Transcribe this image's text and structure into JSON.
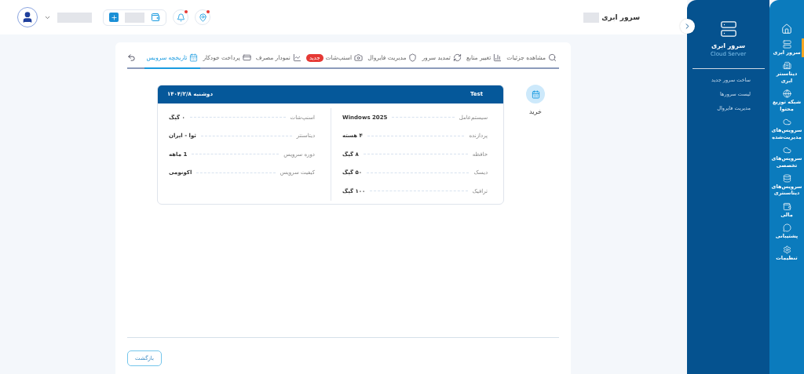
{
  "header": {
    "breadcrumb": "سرور ابری",
    "alerts": [
      {
        "kind": "bell",
        "alert": true
      },
      {
        "kind": "pin",
        "alert": true
      }
    ]
  },
  "rail": [
    {
      "selected": false
    },
    {
      "label": "سرور ابری",
      "selected": true
    },
    {
      "label": "دیتاسنتر ابری",
      "selected": false
    },
    {
      "label": "شبکه توزیع محتوا",
      "selected": false
    },
    {
      "label": "سرویس‌های مدیریت‌شده",
      "selected": false
    },
    {
      "label": "سرویس‌های تخصصی",
      "selected": false
    },
    {
      "label": "سرویس‌های دیتاسنتری",
      "selected": false
    },
    {
      "label": "مالی",
      "selected": false
    },
    {
      "label": "پشتیبانی",
      "selected": false
    },
    {
      "label": "تنظیمات",
      "selected": false
    }
  ],
  "panel": {
    "title": "سرور ابری",
    "subtitle": "Cloud Server",
    "links": [
      "ساخت سرور جدید",
      "لیست سرورها",
      "مدیریت فایروال"
    ]
  },
  "tabs": [
    {
      "label": "مشاهده جزئیات",
      "selected": false
    },
    {
      "label": "تغییر منابع",
      "selected": false
    },
    {
      "label": "تمدید سرور",
      "selected": false
    },
    {
      "label": "مدیریت فایروال",
      "selected": false
    },
    {
      "label": "اسنپ‌شات",
      "badge": "جدید",
      "selected": false
    },
    {
      "label": "نمودار مصرف",
      "selected": false
    },
    {
      "label": "پرداخت خودکار",
      "selected": false
    },
    {
      "label": "تاریخچه سرویس",
      "selected": true
    }
  ],
  "history": [
    {
      "event": "خرید",
      "name": "Test",
      "date": "دوشنبه ۱۴۰۴/۲/۸",
      "right": [
        {
          "label": "سیستم‌عامل",
          "value": "Windows 2025"
        },
        {
          "label": "پردازنده",
          "value": "۴ هسته"
        },
        {
          "label": "حافظه",
          "value": "۸ گیگ"
        },
        {
          "label": "دیسک",
          "value": "۵۰ گیگ"
        },
        {
          "label": "ترافیک",
          "value": "۱۰۰ گیگ"
        }
      ],
      "left": [
        {
          "label": "اسنپ‌شات",
          "value": "۰ گیگ"
        },
        {
          "label": "دیتاسنتر",
          "value": "ثوا - ایران"
        },
        {
          "label": "دوره سرویس",
          "value": "1 ماهه"
        },
        {
          "label": "کیفیت سرویس",
          "value": "اکونومی"
        }
      ]
    }
  ],
  "back_button": "بازگشت"
}
